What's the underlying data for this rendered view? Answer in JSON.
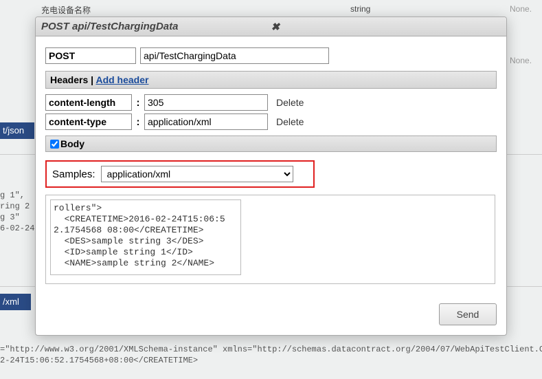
{
  "background": {
    "row1": {
      "label": "充电设备名称",
      "type": "string",
      "none": "None."
    },
    "row2": {
      "none": "None."
    },
    "blue_tab_1": "t/json",
    "blue_tab_2": "/xml",
    "left_snippet": "g 1\",\nring 2\ng 3\"\n6-02-24",
    "bottom_snippet": "=\"http://www.w3.org/2001/XMLSchema-instance\" xmlns=\"http://schemas.datacontract.org/2004/07/WebApiTestClient.Co\n2-24T15:06:52.1754568+08:00</CREATETIME>"
  },
  "dialog": {
    "title": "POST api/TestChargingData",
    "method": "POST",
    "url": "api/TestChargingData",
    "headers_label": "Headers",
    "add_header_label": "Add header",
    "headers": [
      {
        "name": "content-length",
        "value": "305",
        "delete": "Delete"
      },
      {
        "name": "content-type",
        "value": "application/xml",
        "delete": "Delete"
      }
    ],
    "body_label": "Body",
    "body_checked": true,
    "samples_label": "Samples:",
    "samples_selected": "application/xml",
    "body_text": "rollers\">\n  <CREATETIME>2016-02-24T15:06:5\n2.1754568 08:00</CREATETIME>\n  <DES>sample string 3</DES>\n  <ID>sample string 1</ID>\n  <NAME>sample string 2</NAME>",
    "send_label": "Send"
  }
}
